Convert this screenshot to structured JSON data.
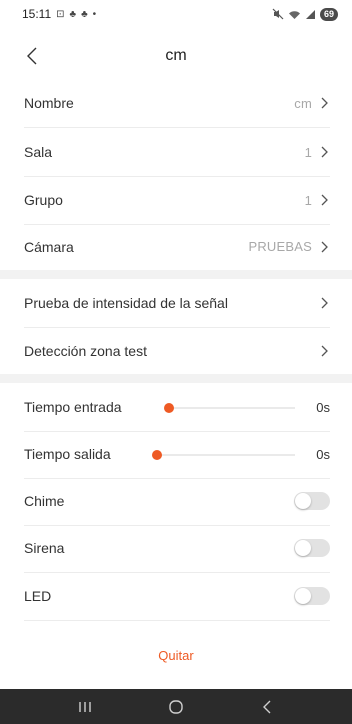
{
  "status_bar": {
    "time": "15:11",
    "left_icons": [
      "screenshot-icon",
      "app-icon",
      "app-icon",
      "dot-icon"
    ],
    "right_icons": [
      "mute-icon",
      "wifi-icon",
      "signal-icon"
    ],
    "battery": "69"
  },
  "header": {
    "title": "cm",
    "back_icon": "chevron-left-icon"
  },
  "group1": [
    {
      "label": "Nombre",
      "value": "cm"
    },
    {
      "label": "Sala",
      "value": "1"
    },
    {
      "label": "Grupo",
      "value": "1"
    },
    {
      "label": "Cámara",
      "value": "PRUEBAS"
    }
  ],
  "group2": [
    {
      "label": "Prueba de intensidad de la señal"
    },
    {
      "label": "Detección zona test"
    }
  ],
  "sliders": [
    {
      "label": "Tiempo entrada",
      "value": "0s",
      "level": 0
    },
    {
      "label": "Tiempo salida",
      "value": "0s",
      "level": 0
    }
  ],
  "toggles": [
    {
      "label": "Chime",
      "on": false
    },
    {
      "label": "Sirena",
      "on": false
    },
    {
      "label": "LED",
      "on": false
    }
  ],
  "quit_label": "Quitar",
  "colors": {
    "accent": "#ee5a24",
    "separator": "#f2f2f2",
    "nav_bar": "#2b2b2b"
  },
  "system_nav": [
    "recents-icon",
    "home-icon",
    "back-icon"
  ]
}
